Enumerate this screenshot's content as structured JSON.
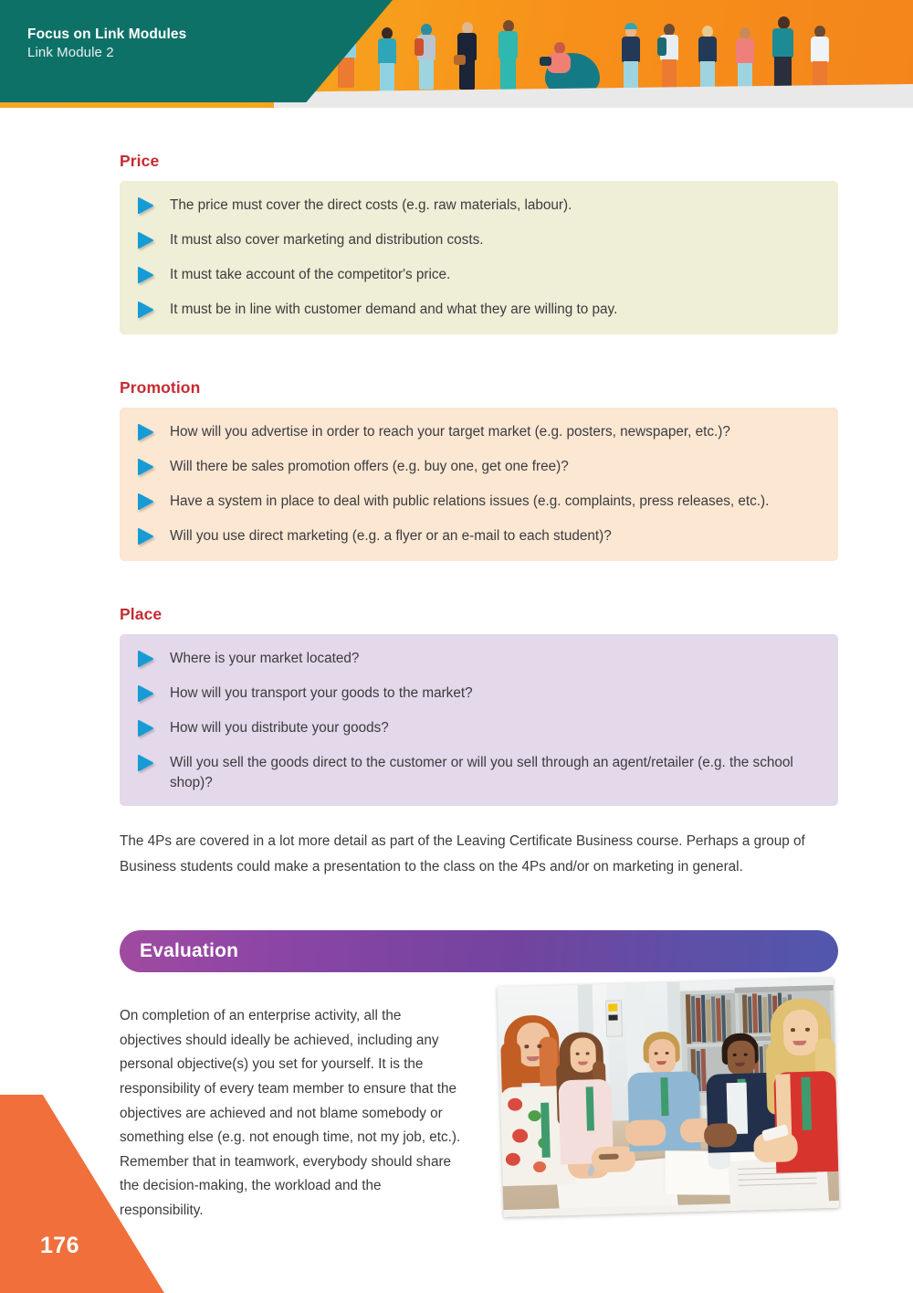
{
  "header": {
    "title": "Focus on Link Modules",
    "subtitle": "Link Module 2",
    "icon_people": "people-illustration-icon",
    "colors": {
      "teal": "#0d7168",
      "orange": "#f5a623",
      "ground": "#e9e9ea"
    }
  },
  "sections": [
    {
      "heading": "Price",
      "theme": "price",
      "bg": "#efeed6",
      "bullets": [
        "The price must cover the direct costs (e.g. raw materials, labour).",
        "It must also cover marketing and distribution costs.",
        "It must take account of the competitor's price.",
        "It must be in line with customer demand and what they are willing to pay."
      ]
    },
    {
      "heading": "Promotion",
      "theme": "promotion",
      "bg": "#fbe7d2",
      "bullets": [
        "How will you advertise in order to reach your target market (e.g. posters, newspaper, etc.)?",
        "Will there be sales promotion offers (e.g. buy one, get one free)?",
        "Have a system in place to deal with public relations issues (e.g. complaints, press releases, etc.).",
        "Will you use direct marketing (e.g. a flyer or an e-mail to each student)?"
      ]
    },
    {
      "heading": "Place",
      "theme": "place",
      "bg": "#e4d9ea",
      "bullets": [
        "Where is your market located?",
        "How will you transport your goods to the market?",
        "How will you distribute your goods?",
        "Will you sell the goods direct to the customer or will you sell through an agent/retailer (e.g. the school shop)?"
      ]
    }
  ],
  "body_paragraph": "The 4Ps are covered in a lot more detail as part of the Leaving Certificate Business course. Perhaps a group of Business students could make a presentation to the class on the 4Ps and/or on marketing in general.",
  "evaluation": {
    "title": "Evaluation",
    "text": "On completion of an enterprise activity, all the objectives should ideally be achieved, including any personal objective(s) you set for yourself. It is the responsibility of every team member to ensure that the objectives are achieved and not blame somebody or something else (e.g. not enough time, not my job, etc.). Remember that in teamwork, everybody should share the decision-making, the workload and the responsibility.",
    "banner_gradient_from": "#a04ba0",
    "banner_gradient_to": "#5157ad",
    "photo_caption": "students-around-table-in-library-photo"
  },
  "footer": {
    "page_number": "176",
    "shape_color": "#f06f3a"
  },
  "icons": {
    "bullet": "blue-triangle-arrow-icon",
    "bullet_color": "#139bd5"
  }
}
